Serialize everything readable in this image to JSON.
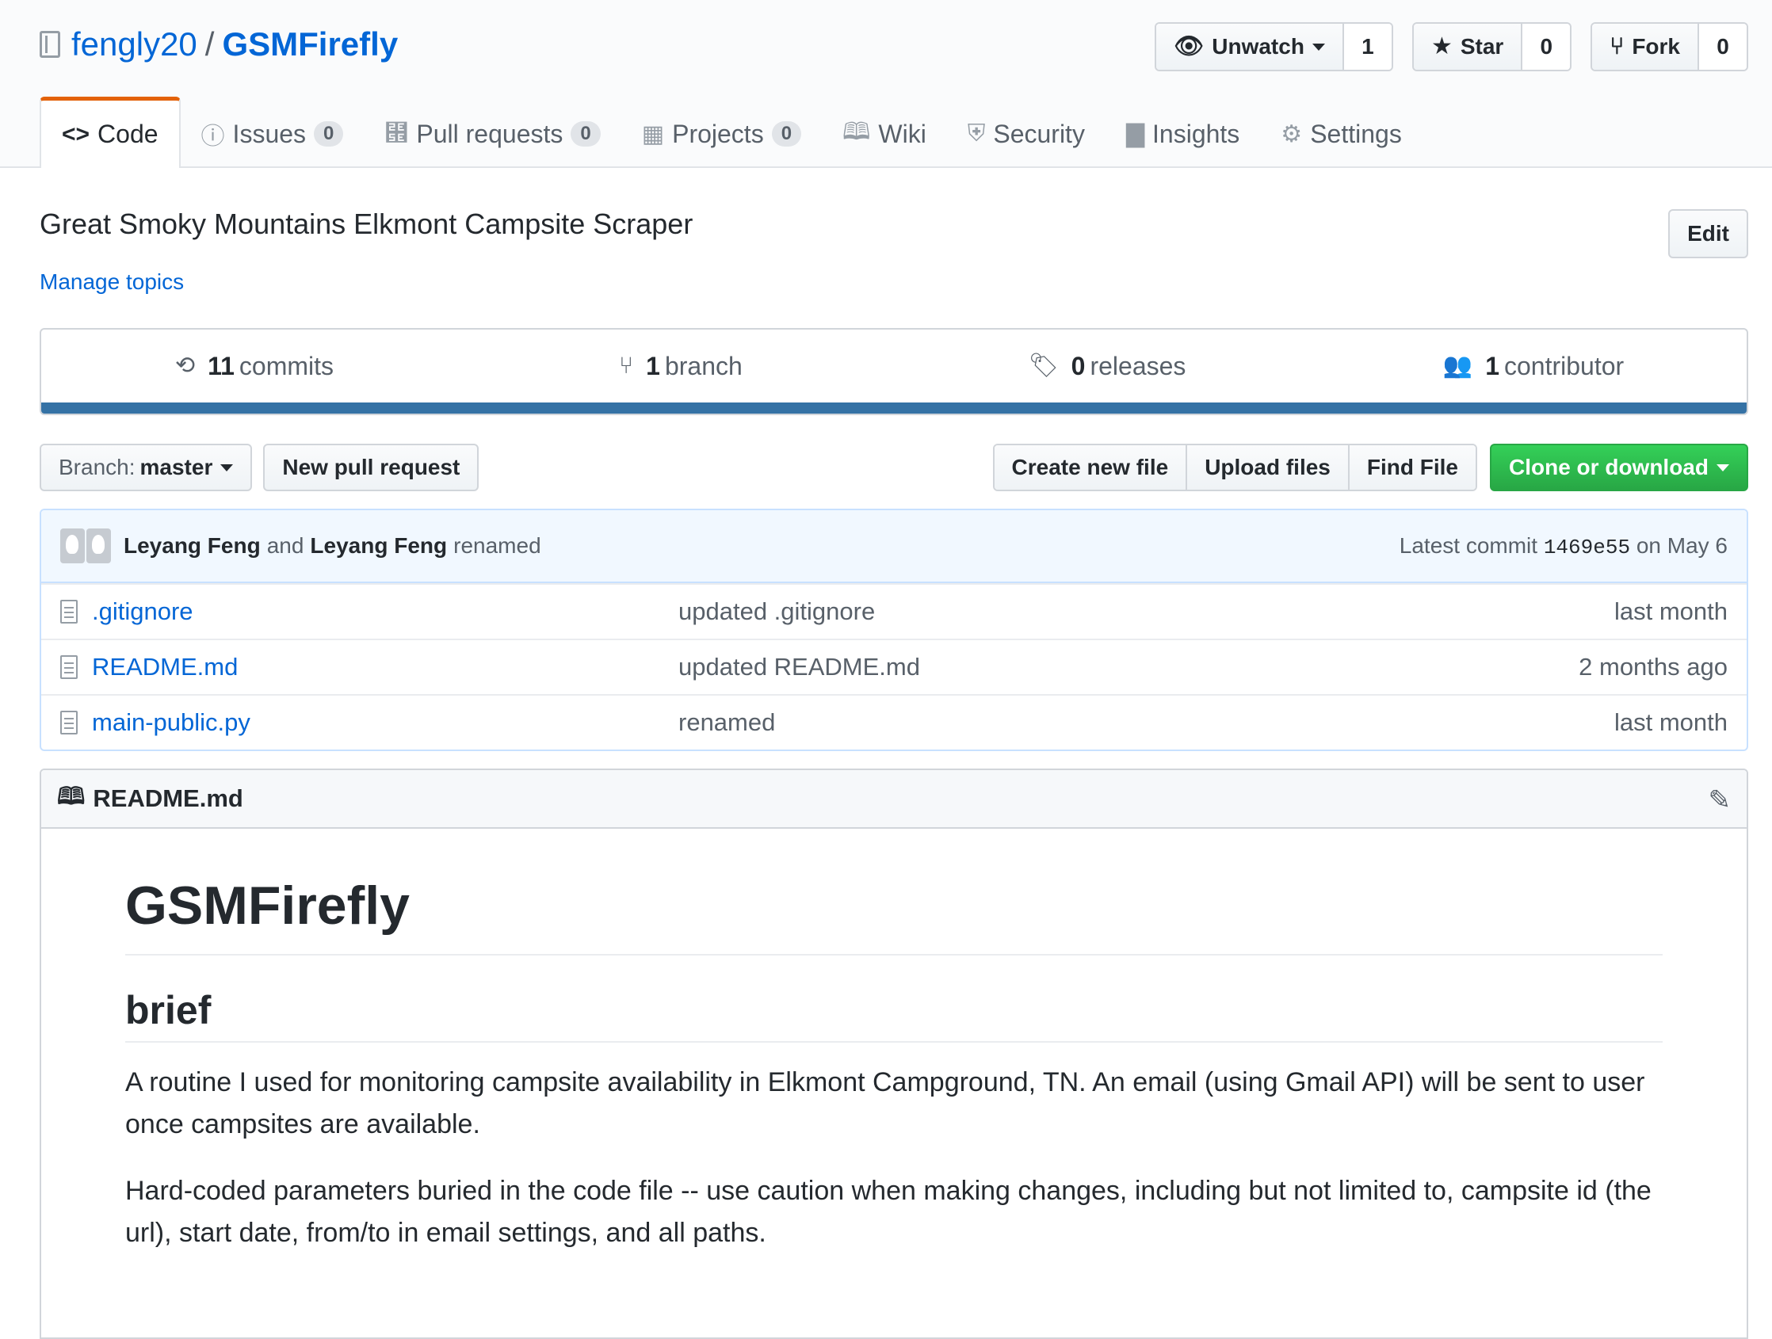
{
  "repo": {
    "owner": "fengly20",
    "name": "GSMFirefly"
  },
  "actions": {
    "watch": {
      "label": "Unwatch",
      "count": "1"
    },
    "star": {
      "label": "Star",
      "count": "0"
    },
    "fork": {
      "label": "Fork",
      "count": "0"
    }
  },
  "tabs": [
    {
      "label": "Code",
      "icon": "code-icon"
    },
    {
      "label": "Issues",
      "count": "0",
      "icon": "issue-icon"
    },
    {
      "label": "Pull requests",
      "count": "0",
      "icon": "pull-request-icon"
    },
    {
      "label": "Projects",
      "count": "0",
      "icon": "project-icon"
    },
    {
      "label": "Wiki",
      "icon": "book-icon"
    },
    {
      "label": "Security",
      "icon": "shield-icon"
    },
    {
      "label": "Insights",
      "icon": "graph-icon"
    },
    {
      "label": "Settings",
      "icon": "gear-icon"
    }
  ],
  "description": "Great Smoky Mountains Elkmont Campsite Scraper",
  "edit_label": "Edit",
  "manage_topics": "Manage topics",
  "numbers": {
    "commits": {
      "count": "11",
      "label": "commits"
    },
    "branches": {
      "count": "1",
      "label": "branch"
    },
    "releases": {
      "count": "0",
      "label": "releases"
    },
    "contributors": {
      "count": "1",
      "label": "contributor"
    }
  },
  "language_color": "#3572A5",
  "filebar": {
    "branch_prefix": "Branch:",
    "branch": "master",
    "new_pr": "New pull request",
    "create_file": "Create new file",
    "upload_files": "Upload files",
    "find_file": "Find File",
    "clone": "Clone or download"
  },
  "latest_commit": {
    "author1": "Leyang Feng",
    "and": "and",
    "author2": "Leyang Feng",
    "message": "renamed",
    "prefix": "Latest commit",
    "sha": "1469e55",
    "date": "on May 6"
  },
  "files": [
    {
      "name": ".gitignore",
      "message": "updated .gitignore",
      "age": "last month"
    },
    {
      "name": "README.md",
      "message": "updated README.md",
      "age": "2 months ago"
    },
    {
      "name": "main-public.py",
      "message": "renamed",
      "age": "last month"
    }
  ],
  "readme": {
    "filename": "README.md",
    "h1": "GSMFirefly",
    "h2": "brief",
    "p1": "A routine I used for monitoring campsite availability in Elkmont Campground, TN. An email (using Gmail API) will be sent to user once campsites are available.",
    "p2": "Hard-coded parameters buried in the code file -- use caution when making changes, including but not limited to, campsite id (the url), start date, from/to in email settings, and all paths."
  }
}
